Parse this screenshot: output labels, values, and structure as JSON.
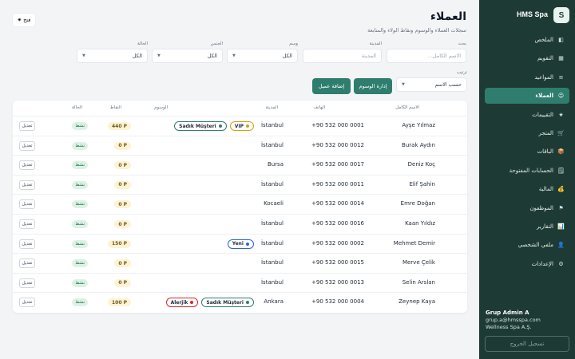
{
  "brand": {
    "logo_letter": "S",
    "name": "HMS Spa"
  },
  "nav": [
    {
      "icon": "◧",
      "icon_name": "dashboard-icon",
      "label": "الملخص",
      "active": false
    },
    {
      "icon": "▦",
      "icon_name": "calendar-icon",
      "label": "التقويم",
      "active": false
    },
    {
      "icon": "≡",
      "icon_name": "list-icon",
      "label": "المواعيد",
      "active": false
    },
    {
      "icon": "☺",
      "icon_name": "customers-icon",
      "label": "العملاء",
      "active": true
    },
    {
      "icon": "★",
      "icon_name": "star-icon",
      "label": "التقييمات",
      "active": false
    },
    {
      "icon": "🛒",
      "icon_name": "cart-icon",
      "label": "المتجر",
      "active": false
    },
    {
      "icon": "📦",
      "icon_name": "package-icon",
      "label": "الباقات",
      "active": false
    },
    {
      "icon": "🗒",
      "icon_name": "receipt-icon",
      "label": "الحسابات المفتوحة",
      "active": false
    },
    {
      "icon": "💰",
      "icon_name": "money-bag-icon",
      "label": "المالية",
      "active": false
    },
    {
      "icon": "⚑",
      "icon_name": "flag-icon",
      "label": "الموظفون",
      "active": false
    },
    {
      "icon": "📊",
      "icon_name": "chart-icon",
      "label": "التقارير",
      "active": false
    },
    {
      "icon": "👤",
      "icon_name": "profile-icon",
      "label": "ملفي الشخصي",
      "active": false
    },
    {
      "icon": "⚙",
      "icon_name": "gear-icon",
      "label": "الإعدادات",
      "active": false
    }
  ],
  "user": {
    "name": "Grup Admin A",
    "email": "grup.a@hmsspa.com",
    "company": "Wellness Spa A.Ş."
  },
  "logout_label": "تسجيل الخروج",
  "header": {
    "title": "العملاء",
    "subtitle": "سجلات العملاء والوسوم ونقاط الولاء والمتابعة",
    "open_button": "فتح"
  },
  "filters": {
    "search": {
      "label": "بحث",
      "placeholder": "الاسم الكامل..."
    },
    "city": {
      "label": "المدينة",
      "placeholder": "المدينة"
    },
    "tag": {
      "label": "وسم",
      "value": "الكل"
    },
    "gender": {
      "label": "الجنس",
      "value": "الكل"
    },
    "status": {
      "label": "الحالة",
      "value": "الكل"
    },
    "sort": {
      "label": "ترتيب",
      "value": "حسب الاسم"
    }
  },
  "actions": {
    "manage_tags": "إدارة الوسوم",
    "add_customer": "إضافة عميل"
  },
  "table": {
    "headers": {
      "name": "الاسم الكامل",
      "phone": "الهاتف",
      "city": "المدينة",
      "tags": "الوسوم",
      "points": "النقاط",
      "status": "الحالة"
    },
    "edit_label": "تعديل",
    "rows": [
      {
        "name": "Ayşe Yılmaz",
        "phone": "+90 532 000 0001",
        "city": "İstanbul",
        "tags": [
          {
            "label": "VIP",
            "color": "#d4a017"
          },
          {
            "label": "Sadık Müşteri",
            "color": "#2f7d6e"
          }
        ],
        "points": "440 P",
        "status": "نشط"
      },
      {
        "name": "Burak Aydın",
        "phone": "+90 532 000 0012",
        "city": "İstanbul",
        "tags": [],
        "points": "0 P",
        "status": "نشط"
      },
      {
        "name": "Deniz Koç",
        "phone": "+90 532 000 0017",
        "city": "Bursa",
        "tags": [],
        "points": "0 P",
        "status": "نشط"
      },
      {
        "name": "Elif Şahin",
        "phone": "+90 532 000 0011",
        "city": "İstanbul",
        "tags": [],
        "points": "0 P",
        "status": "نشط"
      },
      {
        "name": "Emre Doğan",
        "phone": "+90 532 000 0014",
        "city": "Kocaeli",
        "tags": [],
        "points": "0 P",
        "status": "نشط"
      },
      {
        "name": "Kaan Yıldız",
        "phone": "+90 532 000 0016",
        "city": "İstanbul",
        "tags": [],
        "points": "0 P",
        "status": "نشط"
      },
      {
        "name": "Mehmet Demir",
        "phone": "+90 532 000 0002",
        "city": "İstanbul",
        "tags": [
          {
            "label": "Yeni",
            "color": "#2563eb"
          }
        ],
        "points": "150 P",
        "status": "نشط"
      },
      {
        "name": "Merve Çelik",
        "phone": "+90 532 000 0015",
        "city": "İstanbul",
        "tags": [],
        "points": "0 P",
        "status": "نشط"
      },
      {
        "name": "Selin Arslan",
        "phone": "+90 532 000 0013",
        "city": "İstanbul",
        "tags": [],
        "points": "0 P",
        "status": "نشط"
      },
      {
        "name": "Zeynep Kaya",
        "phone": "+90 532 000 0004",
        "city": "Ankara",
        "tags": [
          {
            "label": "Sadık Müşteri",
            "color": "#2f7d6e"
          },
          {
            "label": "Alerjik",
            "color": "#dc2626"
          }
        ],
        "points": "100 P",
        "status": "نشط"
      }
    ]
  }
}
